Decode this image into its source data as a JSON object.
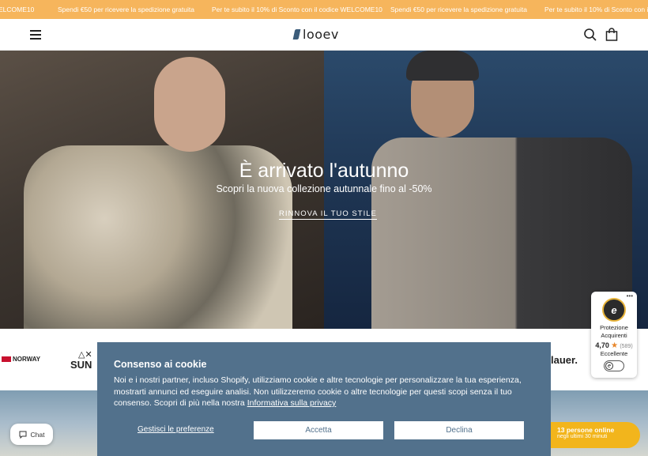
{
  "announcement": {
    "items": [
      "ELCOME10",
      "Spendi €50 per ricevere la spedizione gratuita",
      "Per te subito il 10% di Sconto con il codice WELCOME10",
      "Spendi €50 per ricevere la spedizione gratuita",
      "Per te subito il 10% di Sconto con il co"
    ],
    "color": "#f6b55c"
  },
  "header": {
    "logo_text": "looev",
    "menu_icon": "hamburger-icon",
    "search_icon": "search-icon",
    "cart_icon": "bag-icon"
  },
  "hero": {
    "title": "È arrivato l'autunno",
    "subtitle": "Scopri la nuova collezione autunnale fino al -50%",
    "cta": "RINNOVA IL TUO STILE"
  },
  "brands": {
    "items": [
      "NORWAY",
      "SUN",
      "lauer."
    ]
  },
  "cookie": {
    "title": "Consenso ai cookie",
    "text": "Noi e i nostri partner, incluso Shopify, utilizziamo cookie e altre tecnologie per personalizzare la tua esperienza, mostrarti annunci ed eseguire analisi. Non utilizzeremo cookie o altre tecnologie per questi scopi senza il tuo consenso. Scopri di più nella nostra",
    "privacy_link": "Informativa sulla privacy",
    "manage_label": "Gestisci le preferenze",
    "accept_label": "Accetta",
    "decline_label": "Declina",
    "background": "#52718c"
  },
  "trust_badge": {
    "line1": "Protezione",
    "line2": "Acquirenti",
    "score": "4,70",
    "count": "(589)",
    "rating_label": "Eccellente"
  },
  "chat": {
    "label": "Chat"
  },
  "online": {
    "line1": "13 persone online",
    "line2": "negli ultimi 30 minuti"
  }
}
